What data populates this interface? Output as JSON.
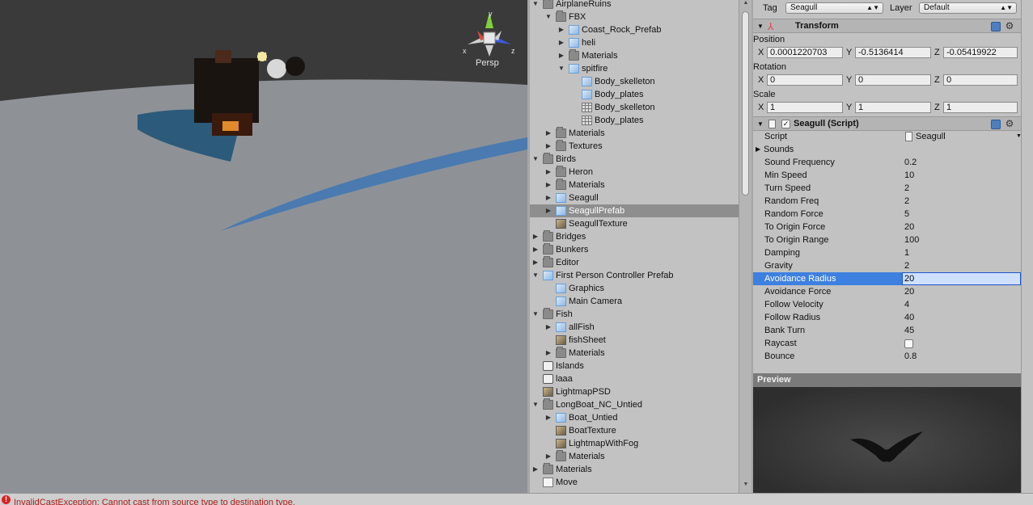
{
  "scene": {
    "persp_label": "Persp",
    "axis_labels": {
      "x": "x",
      "y": "y",
      "z": "z"
    }
  },
  "project": {
    "items": [
      {
        "label": "AirplaneRuins",
        "indent": 0,
        "icon": "folder",
        "expand": "open"
      },
      {
        "label": "FBX",
        "indent": 1,
        "icon": "folder",
        "expand": "open"
      },
      {
        "label": "Coast_Rock_Prefab",
        "indent": 2,
        "icon": "prefab",
        "expand": "closed"
      },
      {
        "label": "heli",
        "indent": 2,
        "icon": "prefab",
        "expand": "closed"
      },
      {
        "label": "Materials",
        "indent": 2,
        "icon": "folder",
        "expand": "closed"
      },
      {
        "label": "spitfire",
        "indent": 2,
        "icon": "prefab",
        "expand": "open"
      },
      {
        "label": "Body_skelleton",
        "indent": 3,
        "icon": "prefab",
        "expand": "none"
      },
      {
        "label": "Body_plates",
        "indent": 3,
        "icon": "prefab",
        "expand": "none"
      },
      {
        "label": "Body_skelleton",
        "indent": 3,
        "icon": "mesh",
        "expand": "none"
      },
      {
        "label": "Body_plates",
        "indent": 3,
        "icon": "mesh",
        "expand": "none"
      },
      {
        "label": "Materials",
        "indent": 1,
        "icon": "folder",
        "expand": "closed"
      },
      {
        "label": "Textures",
        "indent": 1,
        "icon": "folder",
        "expand": "closed"
      },
      {
        "label": "Birds",
        "indent": 0,
        "icon": "folder",
        "expand": "open"
      },
      {
        "label": "Heron",
        "indent": 1,
        "icon": "folder",
        "expand": "closed"
      },
      {
        "label": "Materials",
        "indent": 1,
        "icon": "folder",
        "expand": "closed"
      },
      {
        "label": "Seagull",
        "indent": 1,
        "icon": "prefab",
        "expand": "closed"
      },
      {
        "label": "SeagullPrefab",
        "indent": 1,
        "icon": "prefab",
        "expand": "closed",
        "selected": true
      },
      {
        "label": "SeagullTexture",
        "indent": 1,
        "icon": "texture",
        "expand": "none"
      },
      {
        "label": "Bridges",
        "indent": 0,
        "icon": "folder",
        "expand": "closed"
      },
      {
        "label": "Bunkers",
        "indent": 0,
        "icon": "folder",
        "expand": "closed"
      },
      {
        "label": "Editor",
        "indent": 0,
        "icon": "folder",
        "expand": "closed"
      },
      {
        "label": "First Person Controller Prefab",
        "indent": 0,
        "icon": "prefab",
        "expand": "open"
      },
      {
        "label": "Graphics",
        "indent": 1,
        "icon": "prefab",
        "expand": "none"
      },
      {
        "label": "Main Camera",
        "indent": 1,
        "icon": "prefab",
        "expand": "none"
      },
      {
        "label": "Fish",
        "indent": 0,
        "icon": "folder",
        "expand": "open"
      },
      {
        "label": "allFish",
        "indent": 1,
        "icon": "prefab",
        "expand": "closed"
      },
      {
        "label": "fishSheet",
        "indent": 1,
        "icon": "texture",
        "expand": "none"
      },
      {
        "label": "Materials",
        "indent": 1,
        "icon": "folder",
        "expand": "closed"
      },
      {
        "label": "Islands",
        "indent": 0,
        "icon": "unity",
        "expand": "none"
      },
      {
        "label": "laaa",
        "indent": 0,
        "icon": "unity",
        "expand": "none"
      },
      {
        "label": "LightmapPSD",
        "indent": 0,
        "icon": "texture",
        "expand": "none"
      },
      {
        "label": "LongBoat_NC_Untied",
        "indent": 0,
        "icon": "folder",
        "expand": "open"
      },
      {
        "label": "Boat_Untied",
        "indent": 1,
        "icon": "prefab",
        "expand": "closed"
      },
      {
        "label": "BoatTexture",
        "indent": 1,
        "icon": "texture",
        "expand": "none"
      },
      {
        "label": "LightmapWithFog",
        "indent": 1,
        "icon": "texture",
        "expand": "none"
      },
      {
        "label": "Materials",
        "indent": 1,
        "icon": "folder",
        "expand": "closed"
      },
      {
        "label": "Materials",
        "indent": 0,
        "icon": "folder",
        "expand": "closed"
      },
      {
        "label": "Move",
        "indent": 0,
        "icon": "script",
        "expand": "none"
      }
    ]
  },
  "inspector": {
    "tag_label": "Tag",
    "tag_value": "Seagull",
    "layer_label": "Layer",
    "layer_value": "Default",
    "transform": {
      "title": "Transform",
      "position_label": "Position",
      "position": {
        "x": "0.0001220703",
        "y": "-0.5136414",
        "z": "-0.05419922"
      },
      "rotation_label": "Rotation",
      "rotation": {
        "x": "0",
        "y": "0",
        "z": "0"
      },
      "scale_label": "Scale",
      "scale": {
        "x": "1",
        "y": "1",
        "z": "1"
      },
      "axis": {
        "x": "X",
        "y": "Y",
        "z": "Z"
      }
    },
    "script_component": {
      "title": "Seagull (Script)",
      "enabled": true,
      "script_label": "Script",
      "script_value": "Seagull",
      "sounds_label": "Sounds",
      "properties": [
        {
          "name": "Sound Frequency",
          "value": "0.2"
        },
        {
          "name": "Min Speed",
          "value": "10"
        },
        {
          "name": "Turn Speed",
          "value": "2"
        },
        {
          "name": "Random Freq",
          "value": "2"
        },
        {
          "name": "Random Force",
          "value": "5"
        },
        {
          "name": "To Origin Force",
          "value": "20"
        },
        {
          "name": "To Origin Range",
          "value": "100"
        },
        {
          "name": "Damping",
          "value": "1"
        },
        {
          "name": "Gravity",
          "value": "2"
        },
        {
          "name": "Avoidance Radius",
          "value": "20",
          "editing": true
        },
        {
          "name": "Avoidance Force",
          "value": "20"
        },
        {
          "name": "Follow Velocity",
          "value": "4"
        },
        {
          "name": "Follow Radius",
          "value": "40"
        },
        {
          "name": "Bank Turn",
          "value": "45"
        },
        {
          "name": "Raycast",
          "value": "",
          "checkbox": true,
          "checked": false
        },
        {
          "name": "Bounce",
          "value": "0.8"
        }
      ]
    }
  },
  "preview": {
    "title": "Preview"
  },
  "status": {
    "message": "InvalidCastException: Cannot cast from source type to destination type."
  },
  "colors": {
    "selection": "#3d80df",
    "error": "#b31b1b",
    "panel": "#c2c2c2"
  }
}
